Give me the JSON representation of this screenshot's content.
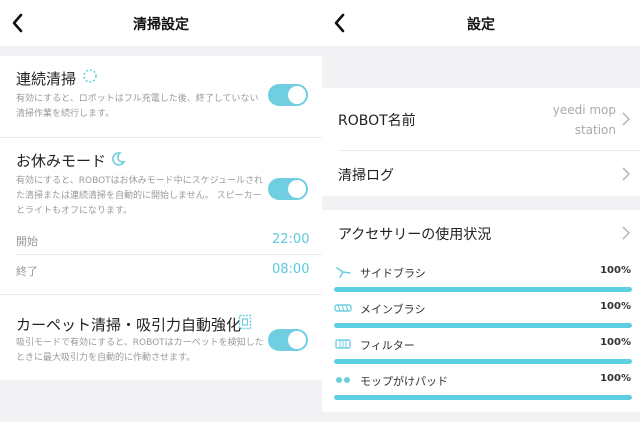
{
  "left": {
    "title": "清掃設定",
    "continuous": {
      "title": "連続清掃",
      "desc": "有効にすると、ロボットはフル充電した後、終了していない清掃作業を続行します。",
      "enabled": true
    },
    "dnd": {
      "title": "お休みモード",
      "desc": "有効にすると、ROBOTはお休みモード中にスケジュールされた清掃または連続清掃を自動的に開始しません。 スピーカーとライトもオフになります。",
      "enabled": true,
      "start_label": "開始",
      "start_time": "22:00",
      "end_label": "終了",
      "end_time": "08:00"
    },
    "carpet": {
      "title": "カーペット清掃・吸引力自動強化",
      "desc": "吸引モードで有効にすると、ROBOTはカーペットを検知したときに最大吸引力を自動的に作動させます。",
      "enabled": true
    }
  },
  "right": {
    "title": "設定",
    "robot_name_label": "ROBOT名前",
    "robot_name_line1": "yeedi mop",
    "robot_name_line2": "station",
    "log_label": "清掃ログ",
    "accessory_label": "アクセサリーの使用状況",
    "accessories": [
      {
        "label": "サイドブラシ",
        "pct_text": "100%",
        "pct": 100,
        "icon": "side-brush-icon"
      },
      {
        "label": "メインブラシ",
        "pct_text": "100%",
        "pct": 100,
        "icon": "main-brush-icon"
      },
      {
        "label": "フィルター",
        "pct_text": "100%",
        "pct": 100,
        "icon": "filter-icon"
      },
      {
        "label": "モップがけパッド",
        "pct_text": "100%",
        "pct": 100,
        "icon": "mop-pad-icon"
      }
    ]
  },
  "colors": {
    "accent": "#5ccfe0",
    "toggle": "#6fcfe0",
    "time": "#5bc9dd"
  }
}
